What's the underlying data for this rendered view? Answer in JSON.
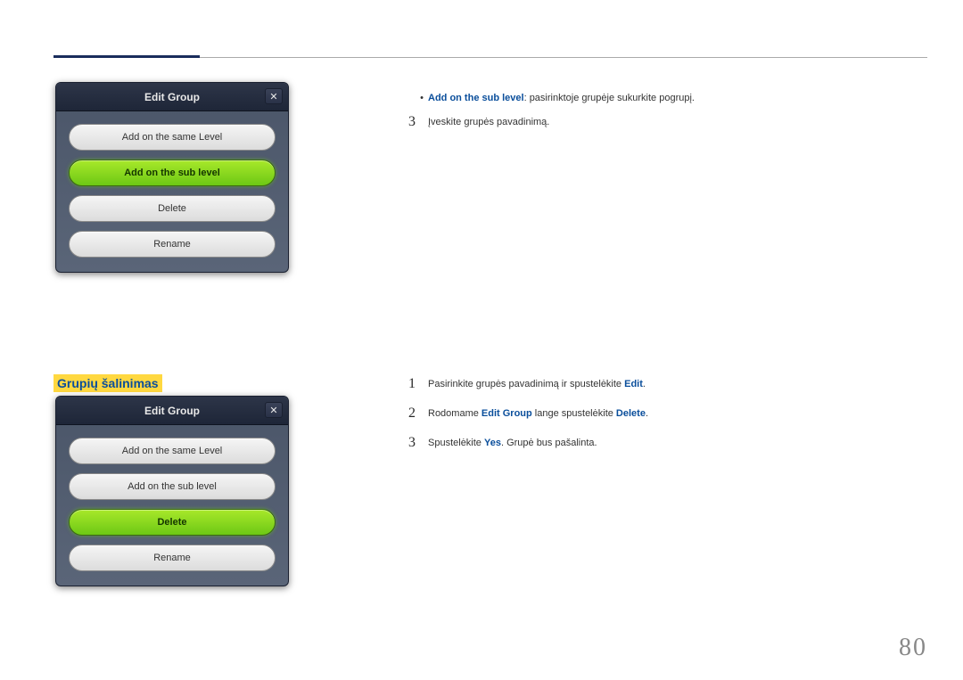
{
  "dialog1": {
    "title": "Edit Group",
    "buttons": {
      "same": "Add on the same Level",
      "sub": "Add on the sub level",
      "delete": "Delete",
      "rename": "Rename"
    }
  },
  "dialog2": {
    "title": "Edit Group",
    "buttons": {
      "same": "Add on the same Level",
      "sub": "Add on the sub level",
      "delete": "Delete",
      "rename": "Rename"
    }
  },
  "bullet1": {
    "em": "Add on the sub level",
    "text": ": pasirinktoje grupėje sukurkite pogrupį."
  },
  "topStep3": {
    "num": "3",
    "text": "Įveskite grupės pavadinimą."
  },
  "heading": "Grupių šalinimas",
  "steps2": {
    "s1": {
      "num": "1",
      "part1": "Pasirinkite grupės pavadinimą ir spustelėkite ",
      "em1": "Edit",
      "part2": "."
    },
    "s2": {
      "num": "2",
      "part1": "Rodomame ",
      "em1": "Edit Group",
      "part2": " lange spustelėkite ",
      "em2": "Delete",
      "part3": "."
    },
    "s3": {
      "num": "3",
      "part1": "Spustelėkite ",
      "em1": "Yes",
      "part2": ". Grupė bus pašalinta."
    }
  },
  "pageNumber": "80"
}
